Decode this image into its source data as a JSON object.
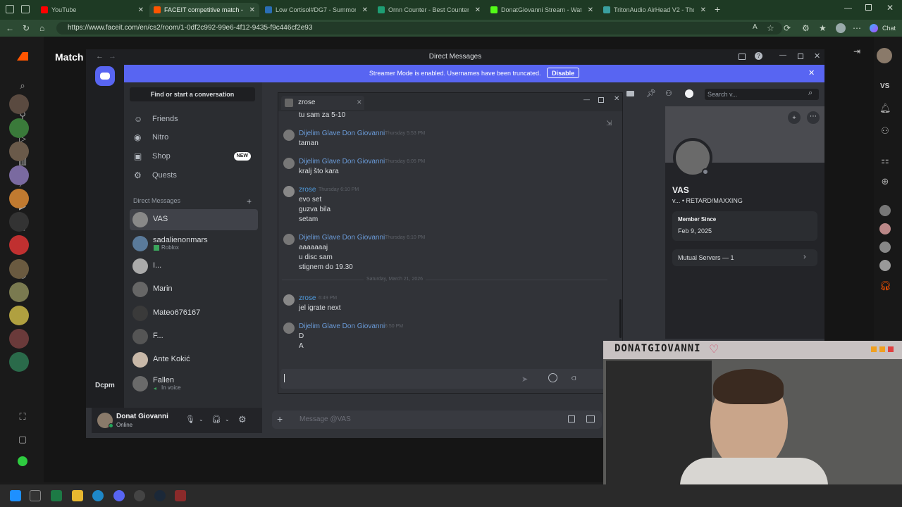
{
  "browser": {
    "tabs": [
      {
        "title": "YouTube",
        "color": "#ff0000"
      },
      {
        "title": "FACEIT competitive match - FACEIT",
        "color": "#ff5500",
        "active": true
      },
      {
        "title": "Low Cortisol#DG7 - Summoner St",
        "color": "#2a6eb5"
      },
      {
        "title": "Ornn Counter - Best Counters fro",
        "color": "#1e9e74"
      },
      {
        "title": "DonatGiovanni Stream - Watch Li",
        "color": "#53fc18"
      },
      {
        "title": "TritonAudio AirHead V2 - Thoma",
        "color": "#3aa0a0"
      }
    ],
    "url": "https://www.faceit.com/en/cs2/room/1-0df2c992-99e6-4f12-9435-f9c446cf2e93",
    "copilot_label": "Chat"
  },
  "faceit": {
    "header_title": "Match",
    "right_label": "VS"
  },
  "discord": {
    "window_title": "Direct Messages",
    "streamer_text": "Streamer Mode is enabled. Usernames have been truncated.",
    "disable_label": "Disable",
    "find_conversation": "Find or start a conversation",
    "nav": [
      {
        "label": "Friends",
        "icon": "friends-icon"
      },
      {
        "label": "Nitro",
        "icon": "nitro-icon"
      },
      {
        "label": "Shop",
        "icon": "shop-icon",
        "badge": "NEW"
      },
      {
        "label": "Quests",
        "icon": "quests-icon"
      }
    ],
    "dm_header": "Direct Messages",
    "dms": [
      {
        "name": "VAS",
        "sub": "",
        "selected": true
      },
      {
        "name": "sadalienonmars",
        "sub": "Roblox"
      },
      {
        "name": "I...",
        "sub": ""
      },
      {
        "name": "Marin",
        "sub": ""
      },
      {
        "name": "Mateo676167",
        "sub": ""
      },
      {
        "name": "F...",
        "sub": ""
      },
      {
        "name": "Ante Kokić",
        "sub": ""
      },
      {
        "name": "Fallen",
        "sub": "In voice"
      }
    ],
    "server_label": "Dcpm",
    "user": {
      "name": "Donat Giovanni",
      "status": "Online"
    },
    "message_placeholder": "Message @VAS",
    "search_placeholder": "Search v...",
    "profile": {
      "name": "VAS",
      "tagline": "v... • RETARD/MAXXING",
      "member_since_label": "Member Since",
      "member_since": "Feb 9, 2025",
      "mutual_servers": "Mutual Servers — 1"
    },
    "popup": {
      "tab": "zrose",
      "messages": [
        {
          "lines": [
            "tu sam za 5-10"
          ]
        },
        {
          "author": "Dijelim Glave Don Giovanni",
          "time": "Thursday 5:53 PM",
          "lines": [
            "taman"
          ]
        },
        {
          "author": "Dijelim Glave Don Giovanni",
          "time": "Thursday 6:05 PM",
          "lines": [
            "kralj što kara"
          ]
        },
        {
          "author": "zrose",
          "time": "Thursday 6:10 PM",
          "lines": [
            "evo set",
            "guzva bila",
            "setam"
          ]
        },
        {
          "author": "Dijelim Glave Don Giovanni",
          "time": "Thursday 6:10 PM",
          "lines": [
            "aaaaaaaj",
            "u disc sam",
            "stignem do 19.30"
          ]
        },
        {
          "author": "zrose",
          "time": "6:49 PM",
          "lines": [
            "jel igrate next"
          ]
        },
        {
          "author": "Dijelim Glave Don Giovanni",
          "time": "6:50 PM",
          "lines": [
            "D",
            "A"
          ]
        }
      ],
      "date_separator": "Saturday, March 21, 2026"
    }
  },
  "webcam": {
    "title": "DONATGIOVANNI"
  }
}
